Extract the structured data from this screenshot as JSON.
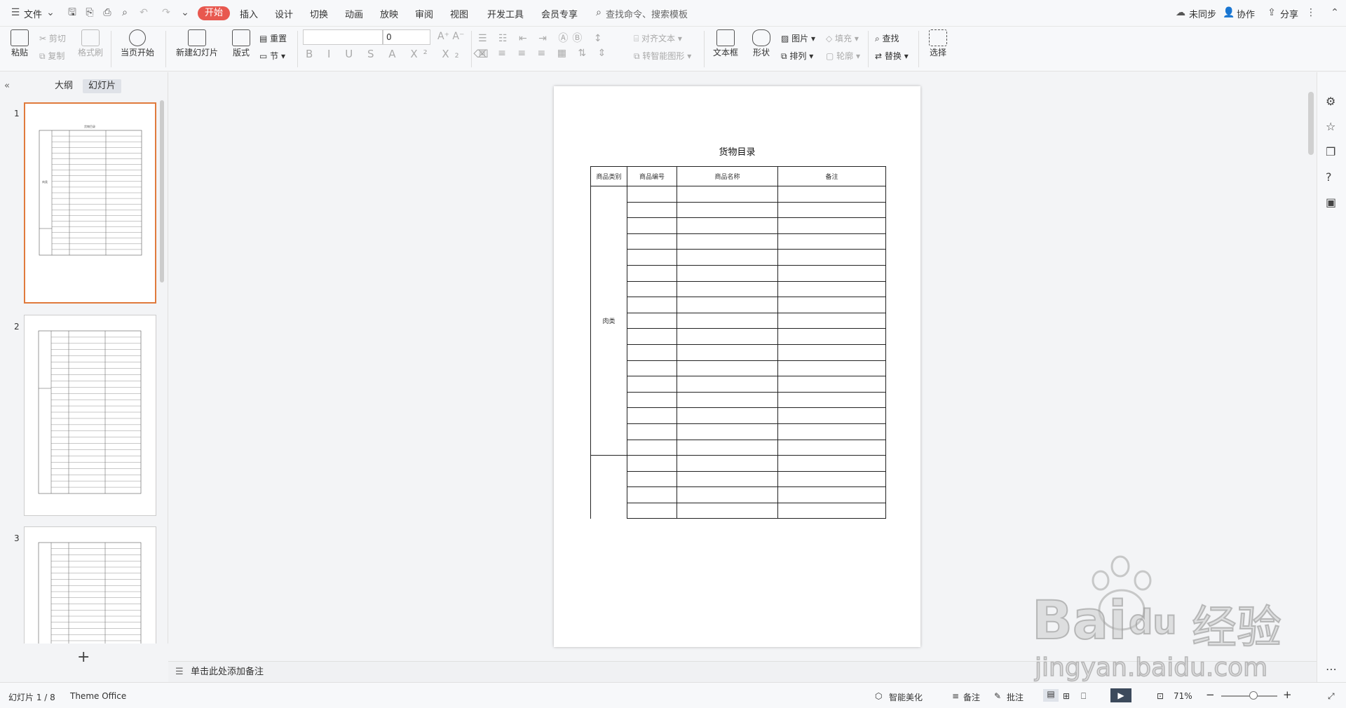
{
  "menubar": {
    "file_label": "文件",
    "tabs": [
      "开始",
      "插入",
      "设计",
      "切换",
      "动画",
      "放映",
      "审阅",
      "视图",
      "开发工具",
      "会员专享"
    ],
    "search_placeholder": "查找命令、搜索模板",
    "sync_label": "未同步",
    "collab_label": "协作",
    "share_label": "分享"
  },
  "ribbon": {
    "paste": "粘贴",
    "cut": "剪切",
    "copy": "复制",
    "format_painter": "格式刷",
    "from_current": "当页开始",
    "new_slide": "新建幻灯片",
    "layout": "版式",
    "reset": "重置",
    "section": "节",
    "font_size": "0",
    "align_text": "对齐文本",
    "smartart": "转智能图形",
    "textbox": "文本框",
    "shape": "形状",
    "picture": "图片",
    "arrange": "排列",
    "fill": "填充",
    "outline": "轮廓",
    "find": "查找",
    "replace": "替换",
    "select": "选择"
  },
  "leftpanel": {
    "tab_outline": "大纲",
    "tab_slides": "幻灯片",
    "slide_numbers": [
      "1",
      "2",
      "3"
    ],
    "add_icon": "plus-icon"
  },
  "slide": {
    "title": "货物目录",
    "headers": [
      "商品类别",
      "商品编号",
      "商品名称",
      "备注"
    ],
    "category_label": "肉类",
    "rows": 21
  },
  "notes": {
    "placeholder": "单击此处添加备注"
  },
  "status": {
    "slide_counter": "幻灯片 1 / 8",
    "theme": "Theme Office",
    "beautify": "智能美化",
    "notes": "备注",
    "comments": "批注",
    "zoom": "71%"
  },
  "watermark": {
    "brand": "Bai",
    "brand2": "du",
    "brand_cn": "经验",
    "url": "jingyan.baidu.com"
  },
  "colors": {
    "accent": "#e8584f",
    "selection": "#e07a3c"
  }
}
